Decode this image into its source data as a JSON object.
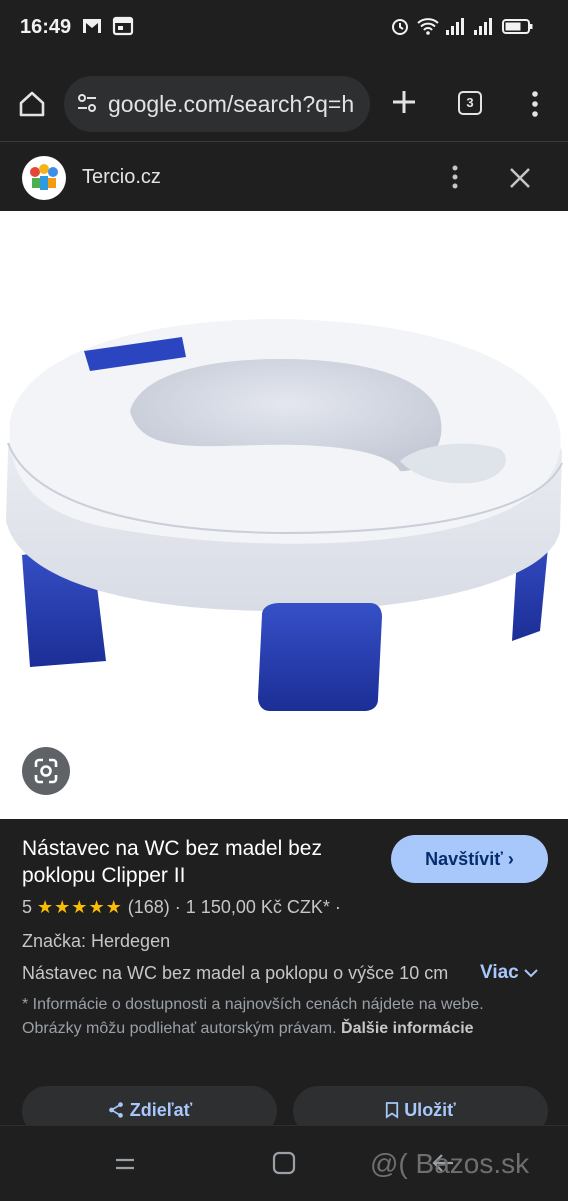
{
  "status": {
    "time": "16:49"
  },
  "browser": {
    "url": "google.com/search?q=h",
    "tab_count": "3"
  },
  "site": {
    "name": "Tercio.cz"
  },
  "product": {
    "title": "Nástavec na WC bez madel bez poklopu Clipper II",
    "visit_label": "Navštíviť",
    "rating_value": "5",
    "stars": "★★★★★",
    "review_count": "(168)",
    "price": "1 150,00 Kč CZK*",
    "brand": "Značka: Herdegen",
    "description": "Nástavec na WC bez madel a poklopu o výšce 10 cm",
    "more_label": "Viac",
    "notice": "* Informácie o dostupnosti a najnovších cenách nájdete na webe. Obrázky môžu podliehať autorským právam.",
    "notice_link": "Ďalšie informácie",
    "share_label": "Zdieľať",
    "save_label": "Uložiť"
  },
  "watermark": "@( Bazos.sk",
  "colors": {
    "accent": "#a8c7fa",
    "background": "#1f1f1f",
    "star": "#fbbc04"
  }
}
